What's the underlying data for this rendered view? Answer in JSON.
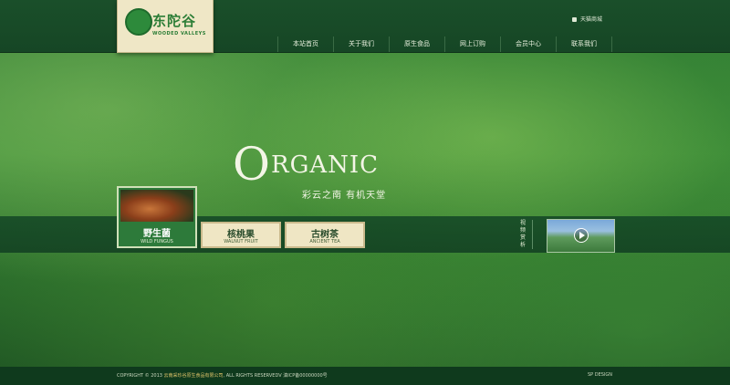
{
  "header": {
    "logo": {
      "cn": "东陀谷",
      "en": "WOODED VALLEYS"
    },
    "tmall_link": "天猫商城",
    "nav": [
      "本站首页",
      "关于我们",
      "原生食品",
      "网上订购",
      "会员中心",
      "联系我们"
    ]
  },
  "hero": {
    "headline_first": "O",
    "headline_rest": "RGANIC",
    "tagline": "彩云之南  有机天堂"
  },
  "products": [
    {
      "cn": "野生菌",
      "en": "WILD FUNGUS",
      "active": true
    },
    {
      "cn": "核桃果",
      "en": "WALNUT FRUIT",
      "active": false
    },
    {
      "cn": "古树茶",
      "en": "ANCIENT TEA",
      "active": false
    }
  ],
  "video": {
    "label": "视频赏析"
  },
  "footer": {
    "copyright_prefix": "COPYRIGHT © 2013",
    "company": "云南采珍谷原生食品有限公司",
    "rights": "ALL RIGHTS RESERVEDV",
    "icp": "滇ICP备00000000号",
    "design": "SP DESIGN"
  }
}
